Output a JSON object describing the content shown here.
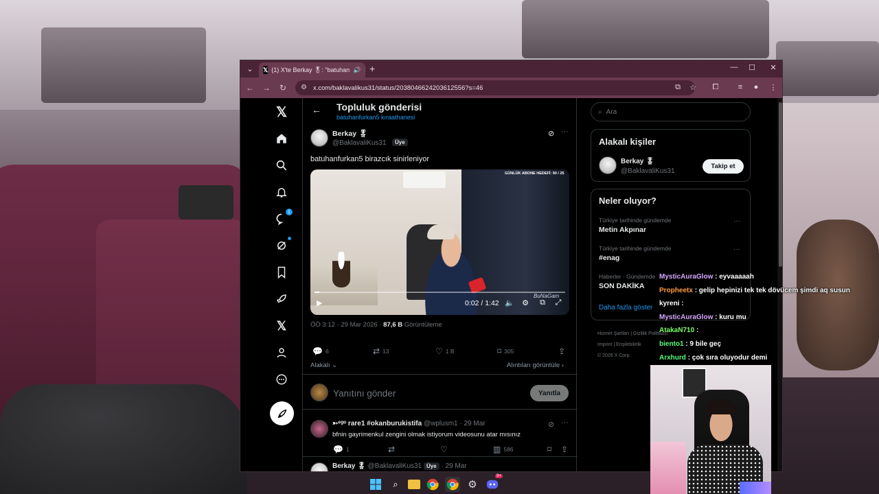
{
  "browser": {
    "tab_title": "(1) X'te Berkay 🎖: \"batuhan",
    "url": "x.com/baklavalikus31/status/2038046624203612556?s=46"
  },
  "header": {
    "title": "Topluluk gönderisi",
    "subtitle": "batuhanfurkan5 kıraathanesi"
  },
  "nav": {
    "messages_badge": "1",
    "icons": [
      "x-logo-icon",
      "home-icon",
      "search-icon",
      "notifications-icon",
      "messages-icon",
      "grok-icon",
      "bookmarks-icon",
      "rocket-icon",
      "x-premium-icon",
      "profile-icon",
      "more-icon",
      "compose-icon"
    ]
  },
  "tweet": {
    "author_name": "Berkay 🎖",
    "author_handle": "@BaklavaliKus31",
    "member_badge": "Üye",
    "text": "batuhanfurkan5 birazcık sinirleniyor",
    "video": {
      "goal_text": "GÜNLÜK ABONE HEDEFİ: 90 / 25",
      "time": "0:02 / 1:42",
      "watermark": "BuNaGam",
      "progress": 0.02
    },
    "time": "ÖÖ 3:12 · 29 Mar 2026 ·",
    "views_value": "87,6 B",
    "views_label": "Görüntüleme",
    "replies": "6",
    "retweets": "13",
    "likes": "1 B",
    "bookmarks": "305",
    "relevant": "Alakalı ⌄",
    "see_quotes": "Alıntıları görüntüle ›"
  },
  "reply_box": {
    "placeholder": "Yanıtını gönder",
    "button": "Yanıtla"
  },
  "replies": [
    {
      "name": "➳ᵉᵍᵒ rare1 #okanburukistifa",
      "handle": "@wplusm1 · 29 Mar",
      "text": "bfnin gayrimenkul zengini olmak istiyorum videosunu atar mısınız",
      "replies": "1",
      "views": "586"
    },
    {
      "name": "Berkay 🎖",
      "handle": "@BaklavaliKus31",
      "badge": "Üye",
      "date": "· 29 Mar"
    }
  ],
  "sidebar": {
    "search_placeholder": "Ara",
    "people_title": "Alakalı kişiler",
    "person_name": "Berkay 🎖",
    "person_handle": "@BaklavaliKus31",
    "follow_label": "Takip et",
    "trends_title": "Neler oluyor?",
    "trends": [
      {
        "category": "Türkiye tarihinde gündemde",
        "name": "Metin Akpınar"
      },
      {
        "category": "Türkiye tarihinde gündemde",
        "name": "#enag"
      },
      {
        "category": "Haberler · Gündemde",
        "name": "SON DAKİKA"
      }
    ],
    "show_more": "Daha fazla göster",
    "footer_1": "Hizmet Şartları | Gizlilik Politikası",
    "footer_2": "Imprint | Erişilebilirlik",
    "footer_3": "© 2026 X Corp."
  },
  "chat": [
    {
      "user": "MysticAuraGlow",
      "color": "#d7a6ff",
      "msg": ": eyvaaaaah"
    },
    {
      "user": "Propheetx",
      "color": "#ff9a3c",
      "msg": ": gelip hepinizi tek tek dövücem şimdi aq susun"
    },
    {
      "user": "kyreni",
      "color": "#ffffff",
      "msg": ":"
    },
    {
      "user": "MysticAuraGlow",
      "color": "#d7a6ff",
      "msg": ": kuru mu"
    },
    {
      "user": "AtakaN710",
      "color": "#7cff6a",
      "msg": ":"
    },
    {
      "user": "biento1",
      "color": "#59ff7a",
      "msg": ": 9 bile geç"
    },
    {
      "user": "Arxhurd",
      "color": "#59ff7a",
      "msg": ": çok sıra oluyodur demi"
    }
  ],
  "taskbar": {
    "icons": [
      "windows-start-icon",
      "search-icon",
      "file-explorer-icon",
      "chrome-icon",
      "chrome-active-icon",
      "app-icon",
      "discord-icon"
    ],
    "discord_badge": "9+"
  }
}
